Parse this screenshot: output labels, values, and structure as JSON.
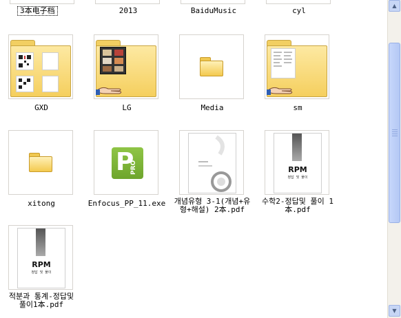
{
  "window": {
    "title": ""
  },
  "top_row": [
    {
      "name": "3本电子档",
      "selected": true
    },
    {
      "name": "2013"
    },
    {
      "name": "BaiduMusic"
    },
    {
      "name": "cyl"
    }
  ],
  "row2": [
    {
      "name": "GXD",
      "kind": "folder-shared"
    },
    {
      "name": "LG",
      "kind": "folder-shared"
    },
    {
      "name": "Media",
      "kind": "folder"
    },
    {
      "name": "sm",
      "kind": "folder-shared"
    }
  ],
  "row3": [
    {
      "name": "xitong",
      "kind": "folder"
    },
    {
      "name": "Enfocus_PP_11.exe",
      "kind": "exe"
    },
    {
      "name_line1": "개념유형 3-1(개념+유",
      "name_line2": "형+해설) 2本.pdf",
      "kind": "pdf"
    },
    {
      "name_line1": "수학2-정답및 풀이 1",
      "name_line2": "本.pdf",
      "kind": "pdf"
    }
  ],
  "row4": [
    {
      "name_line1": "적분과 통계-정답및",
      "name_line2": "풀이1本.pdf",
      "kind": "pdf"
    }
  ],
  "thumb_text": {
    "rpm": "RPM",
    "rpm_sub": "정답 및 풀이",
    "pro": "PRO",
    "p": "P"
  },
  "scrollbar": {
    "up": "▲",
    "down": "▼"
  },
  "colors": {
    "folder": "#f5cf5e",
    "enfocus_green": "#7fb437",
    "scroll_thumb": "#b4c8f4"
  }
}
